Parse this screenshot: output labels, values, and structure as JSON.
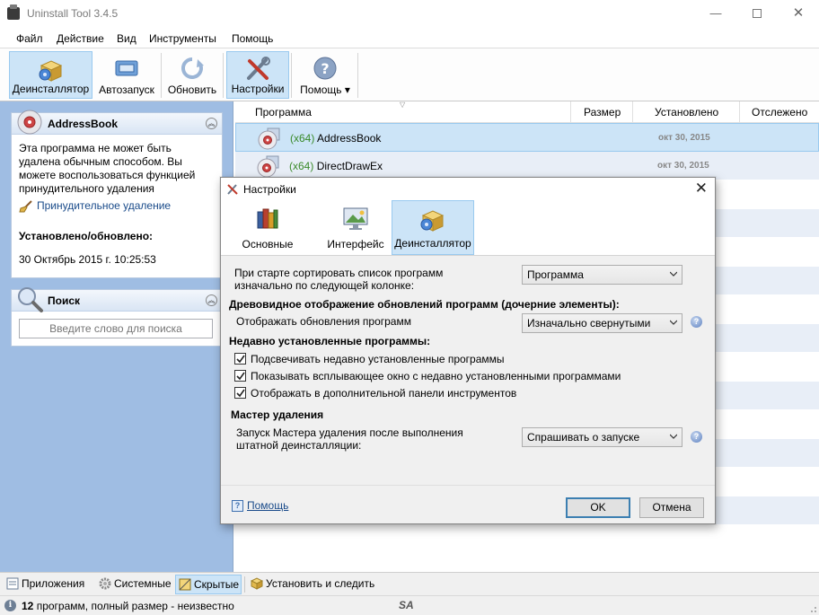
{
  "window": {
    "title": "Uninstall Tool 3.4.5"
  },
  "menu": [
    "Файл",
    "Действие",
    "Вид",
    "Инструменты",
    "Помощь"
  ],
  "toolbar": {
    "uninstaller": "Деинсталлятор",
    "autorun": "Автозапуск",
    "refresh": "Обновить",
    "settings": "Настройки",
    "help": "Помощь"
  },
  "sidebar": {
    "app_card": {
      "title": "AddressBook",
      "description": "Эта программа не может быть удалена обычным способом. Вы можете воспользоваться функцией принудительного удаления",
      "force_link": "Принудительное удаление",
      "installed_label": "Установлено/обновлено:",
      "installed_value": "30 Октябрь 2015 г. 10:25:53"
    },
    "search_card": {
      "title": "Поиск",
      "placeholder": "Введите слово для поиска"
    }
  },
  "list": {
    "columns": [
      "Программа",
      "Размер",
      "Установлено",
      "Отслежено"
    ],
    "rows": [
      {
        "arch": "(x64)",
        "name": "AddressBook",
        "date": "окт 30, 2015",
        "selected": true
      },
      {
        "arch": "(x64)",
        "name": "DirectDrawEx",
        "date": "окт 30, 2015",
        "selected": false
      }
    ]
  },
  "tabs": {
    "apps": "Приложения",
    "system": "Системные",
    "hidden": "Скрытые",
    "install_track": "Установить и следить"
  },
  "status": {
    "count": "12",
    "text": "программ, полный размер - неизвестно",
    "logo": "SA"
  },
  "dialog": {
    "title": "Настройки",
    "tabs": {
      "general": "Основные",
      "interface": "Интерфейс",
      "uninstaller": "Деинсталлятор"
    },
    "sort_label": "При старте сортировать список программ изначально по следующей колонке:",
    "sort_value": "Программа",
    "tree_header": "Древовидное отображение обновлений программ (дочерние элементы):",
    "updates_label": "Отображать обновления программ",
    "updates_value": "Изначально свернутыми",
    "recent_header": "Недавно установленные программы:",
    "checkboxes": [
      {
        "label": "Подсвечивать недавно установленные программы",
        "checked": true
      },
      {
        "label": "Показывать всплывающее окно с недавно установленными программами",
        "checked": true
      },
      {
        "label": "Отображать в дополнительной панели инструментов",
        "checked": true
      }
    ],
    "wizard_header": "Мастер удаления",
    "wizard_label": "Запуск Мастера удаления после выполнения штатной деинсталляции:",
    "wizard_value": "Спрашивать о запуске",
    "help_link": "Помощь",
    "ok": "OK",
    "cancel": "Отмена"
  },
  "colors": {
    "accent_selection": "#cce4f7",
    "sidebar_bg": "#9fbde3",
    "recent_app": "#3a8a2a"
  }
}
